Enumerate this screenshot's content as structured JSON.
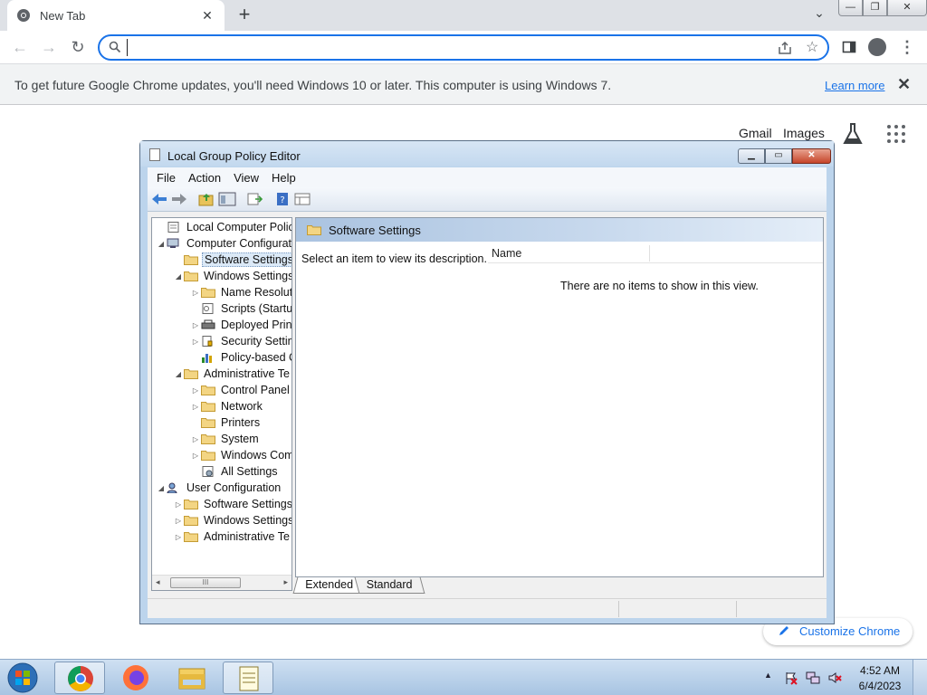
{
  "browser": {
    "tab_title": "New Tab",
    "new_tab_glyph": "+",
    "omnibox_value": "",
    "icons": {
      "back": "arrow-left-icon",
      "forward": "arrow-right-icon",
      "reload": "reload-icon",
      "search": "search-icon",
      "share": "share-icon",
      "bookmark": "star-icon",
      "side_panel": "side-panel-icon",
      "profile": "profile-icon",
      "menu": "menu-dots-icon"
    },
    "accent_color": "#1a73e8"
  },
  "infobar": {
    "message": "To get future Google Chrome updates, you'll need Windows 10 or later. This computer is using Windows 7.",
    "learn_more": "Learn more",
    "close_glyph": "✕"
  },
  "ntp": {
    "gmail": "Gmail",
    "images": "Images",
    "customize": "Customize Chrome"
  },
  "gpe": {
    "title": "Local Group Policy Editor",
    "menu": [
      "File",
      "Action",
      "View",
      "Help"
    ],
    "tree": [
      {
        "label": "Local Computer Policy",
        "level": 0,
        "expander": "",
        "icon": "policy-icon"
      },
      {
        "label": "Computer Configurat",
        "level": 0,
        "expander": "◢",
        "icon": "computer-icon"
      },
      {
        "label": "Software Settings",
        "level": 1,
        "expander": "",
        "icon": "folder-icon",
        "selected": true
      },
      {
        "label": "Windows Settings",
        "level": 1,
        "expander": "◢",
        "icon": "folder-icon"
      },
      {
        "label": "Name Resoluti",
        "level": 2,
        "expander": "▷",
        "icon": "folder-icon"
      },
      {
        "label": "Scripts (Startu",
        "level": 2,
        "expander": "",
        "icon": "script-icon"
      },
      {
        "label": "Deployed Print",
        "level": 2,
        "expander": "▷",
        "icon": "printer-icon"
      },
      {
        "label": "Security Settin",
        "level": 2,
        "expander": "▷",
        "icon": "security-icon"
      },
      {
        "label": "Policy-based C",
        "level": 2,
        "expander": "",
        "icon": "chart-icon"
      },
      {
        "label": "Administrative Te",
        "level": 1,
        "expander": "◢",
        "icon": "folder-icon"
      },
      {
        "label": "Control Panel",
        "level": 2,
        "expander": "▷",
        "icon": "folder-icon"
      },
      {
        "label": "Network",
        "level": 2,
        "expander": "▷",
        "icon": "folder-icon"
      },
      {
        "label": "Printers",
        "level": 2,
        "expander": "",
        "icon": "folder-icon"
      },
      {
        "label": "System",
        "level": 2,
        "expander": "▷",
        "icon": "folder-icon"
      },
      {
        "label": "Windows Com",
        "level": 2,
        "expander": "▷",
        "icon": "folder-icon"
      },
      {
        "label": "All Settings",
        "level": 2,
        "expander": "",
        "icon": "all-settings-icon"
      },
      {
        "label": "User Configuration",
        "level": 0,
        "expander": "◢",
        "icon": "user-icon"
      },
      {
        "label": "Software Settings",
        "level": 1,
        "expander": "▷",
        "icon": "folder-icon"
      },
      {
        "label": "Windows Settings",
        "level": 1,
        "expander": "▷",
        "icon": "folder-icon"
      },
      {
        "label": "Administrative Te",
        "level": 1,
        "expander": "▷",
        "icon": "folder-icon"
      }
    ],
    "right_header": "Software Settings",
    "description": "Select an item to view its description.",
    "column_name": "Name",
    "empty_text": "There are no items to show in this view.",
    "view_tabs": [
      "Extended",
      "Standard"
    ],
    "scroll_thumb": "III"
  },
  "taskbar": {
    "time": "4:52 AM",
    "date": "6/4/2023",
    "apps": [
      "chrome-icon",
      "firefox-icon",
      "file-explorer-icon",
      "notepad-icon"
    ]
  }
}
